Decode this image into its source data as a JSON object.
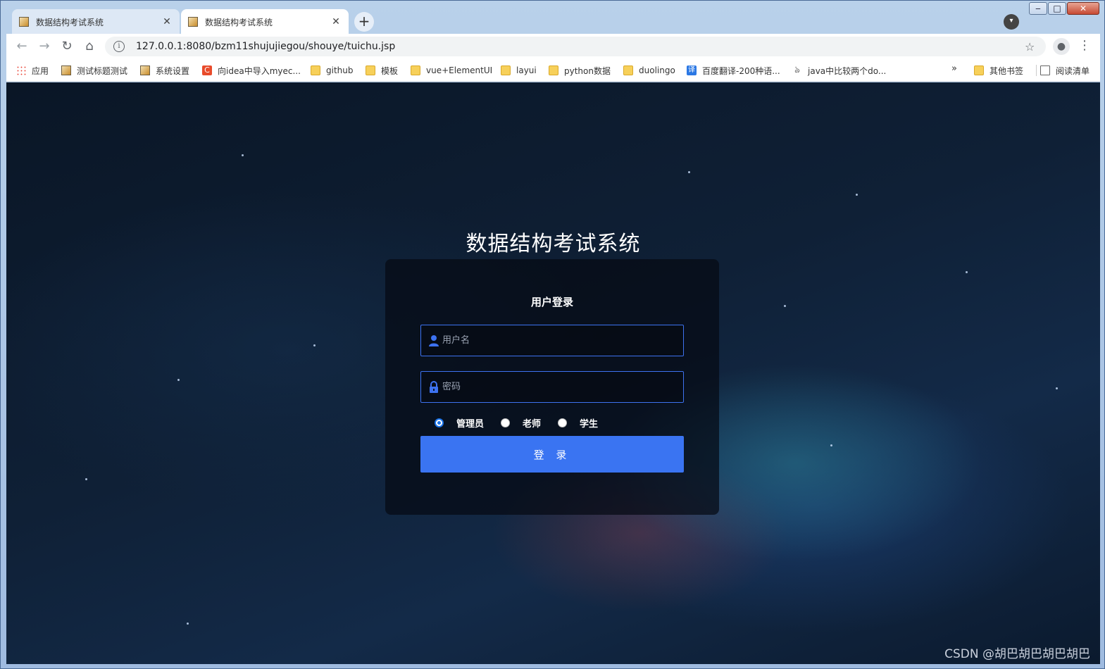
{
  "browser": {
    "tabs": [
      {
        "title": "数据结构考试系统",
        "active": false
      },
      {
        "title": "数据结构考试系统",
        "active": true
      }
    ],
    "new_tab": "+",
    "window_controls": {
      "minimize": "‒",
      "maximize": "□",
      "close": "✕"
    },
    "url": "127.0.0.1:8080/bzm11shujujiegou/shouye/tuichu.jsp",
    "bookmarks": [
      {
        "label": "应用",
        "icon": "apps-grid-icon"
      },
      {
        "label": "测试标题测试",
        "icon": "image-icon"
      },
      {
        "label": "系统设置",
        "icon": "image-icon"
      },
      {
        "label": "向idea中导入myec...",
        "icon": "csdn-icon"
      },
      {
        "label": "github",
        "icon": "folder-icon"
      },
      {
        "label": "模板",
        "icon": "folder-icon"
      },
      {
        "label": "vue+ElementUI",
        "icon": "folder-icon"
      },
      {
        "label": "layui",
        "icon": "folder-icon"
      },
      {
        "label": "python数据",
        "icon": "folder-icon"
      },
      {
        "label": "duolingo",
        "icon": "folder-icon"
      },
      {
        "label": "百度翻译-200种语...",
        "icon": "translate-icon"
      },
      {
        "label": "java中比较两个do...",
        "icon": "generic-icon"
      }
    ],
    "bookmarks_more": "»",
    "other_bookmarks": "其他书签",
    "reading_list": "阅读清单"
  },
  "page": {
    "title": "数据结构考试系统",
    "login_heading": "用户登录",
    "username_placeholder": "用户名",
    "password_placeholder": "密码",
    "roles": [
      {
        "label": "管理员",
        "checked": true
      },
      {
        "label": "老师",
        "checked": false
      },
      {
        "label": "学生",
        "checked": false
      }
    ],
    "login_button": "登 录",
    "colors": {
      "accent": "#3a74f2",
      "field_border": "#3d72f0"
    }
  },
  "watermark": "CSDN @胡巴胡巴胡巴胡巴"
}
